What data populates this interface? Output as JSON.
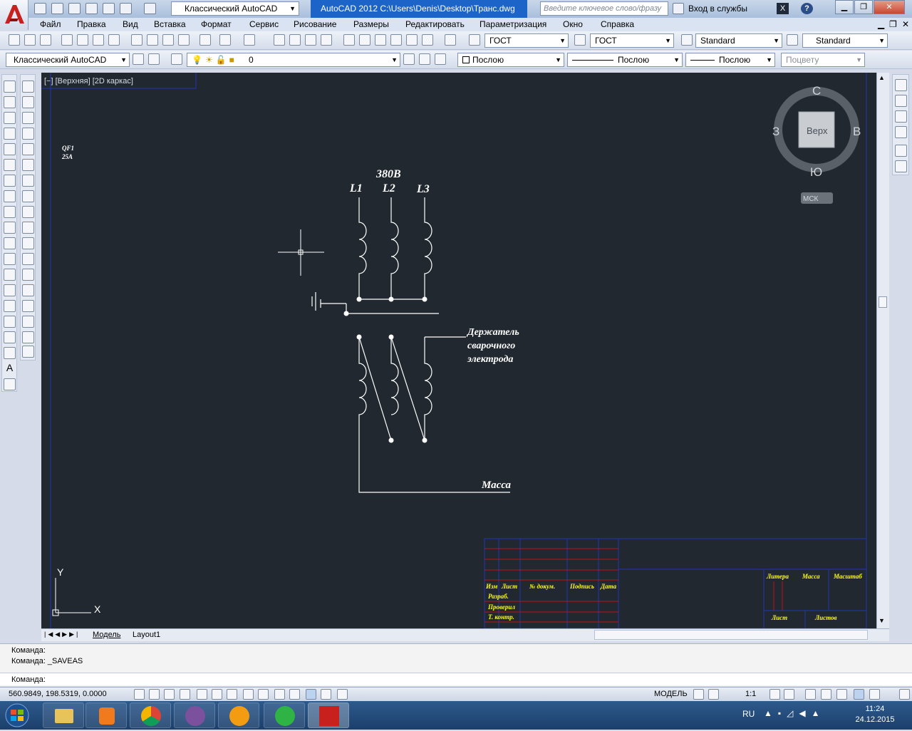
{
  "window": {
    "workspace": "Классический AutoCAD",
    "title": "AutoCAD 2012    C:\\Users\\Denis\\Desktop\\Транс.dwg",
    "search_placeholder": "Введите ключевое слово/фразу",
    "signin": "Вход в службы"
  },
  "menu": [
    "Файл",
    "Правка",
    "Вид",
    "Вставка",
    "Формат",
    "Сервис",
    "Рисование",
    "Размеры",
    "Редактировать",
    "Параметризация",
    "Окно",
    "Справка"
  ],
  "styles_toolbar": {
    "text_style": "ГОСТ",
    "dim_style": "ГОСТ",
    "table_style": "Standard",
    "mleader_style": "Standard"
  },
  "layers_toolbar": {
    "workspace": "Классический AutoCAD",
    "layer": "0",
    "color": "Послою",
    "linetype": "Послою",
    "lineweight": "Послою",
    "plotstyle": "Поцвету"
  },
  "viewport": {
    "label": "[−] [Верхняя] [2D каркас]",
    "viewcube": {
      "north": "С",
      "south": "Ю",
      "west": "З",
      "east": "В",
      "face": "Верх",
      "ucs": "МСК"
    }
  },
  "drawing_text": {
    "breaker_1": "QF1",
    "breaker_2": "25A",
    "voltage": "380В",
    "phase_1": "L1",
    "phase_2": "L2",
    "phase_3": "L3",
    "holder_1": "Держатель",
    "holder_2": "сварочного",
    "holder_3": "электрода",
    "ground": "Масса",
    "tb_izm": "Изм",
    "tb_list": "Лист",
    "tb_doc": "№ докум.",
    "tb_sign": "Подпись",
    "tb_date": "Дата",
    "tb_razrab": "Разраб.",
    "tb_prover": "Проверил",
    "tb_tkontr": "Т. контр.",
    "tb_litera": "Литера",
    "tb_massa": "Масса",
    "tb_masshtab": "Масштаб",
    "tb_sheet": "Лист",
    "tb_sheets": "Листов",
    "ucs_x": "X",
    "ucs_y": "Y"
  },
  "tabs": [
    "Модель",
    "Layout1"
  ],
  "command": {
    "line1": "Команда:",
    "line2": "Команда:  _SAVEAS",
    "prompt": "Команда:"
  },
  "status": {
    "coords": "560.9849, 198.5319, 0.0000",
    "space": "МОДЕЛЬ",
    "scale": "1:1"
  },
  "taskbar": {
    "lang": "RU",
    "time": "11:24",
    "date": "24.12.2015"
  }
}
